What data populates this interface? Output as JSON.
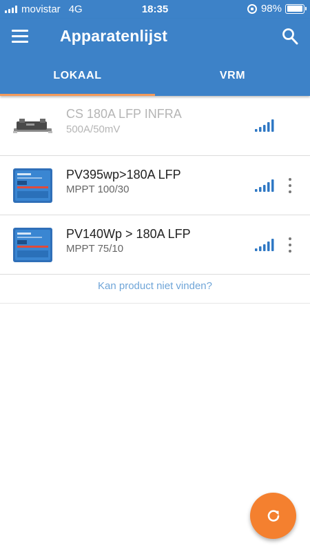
{
  "status_bar": {
    "carrier": "movistar",
    "network": "4G",
    "time": "18:35",
    "battery": "98%",
    "battery_level": 0.98
  },
  "app_bar": {
    "title": "Apparatenlijst",
    "menu_icon": "menu-icon",
    "search_icon": "search-icon",
    "background_color": "#3d82c8"
  },
  "tabs": [
    {
      "label": "LOKAAL",
      "active": true
    },
    {
      "label": "VRM",
      "active": false
    }
  ],
  "devices": [
    {
      "name": "CS 180A LFP INFRA",
      "subtitle": "500A/50mV",
      "icon": "shunt-device-icon",
      "signal_bars": 5,
      "has_menu": false,
      "inactive": true
    },
    {
      "name": "PV395wp>180A LFP",
      "subtitle": "MPPT 100/30",
      "icon": "mppt-controller-icon",
      "signal_bars": 5,
      "has_menu": true,
      "inactive": false
    },
    {
      "name": "PV140Wp > 180A LFP",
      "subtitle": "MPPT 75/10",
      "icon": "mppt-controller-icon",
      "signal_bars": 5,
      "has_menu": true,
      "inactive": false
    }
  ],
  "not_found_link": "Kan product niet vinden?",
  "fab": {
    "icon": "refresh-icon",
    "color": "#f4802f"
  },
  "colors": {
    "accent_tab": "#f39a5b",
    "signal": "#2f78c4",
    "link": "#6fa5d8"
  }
}
